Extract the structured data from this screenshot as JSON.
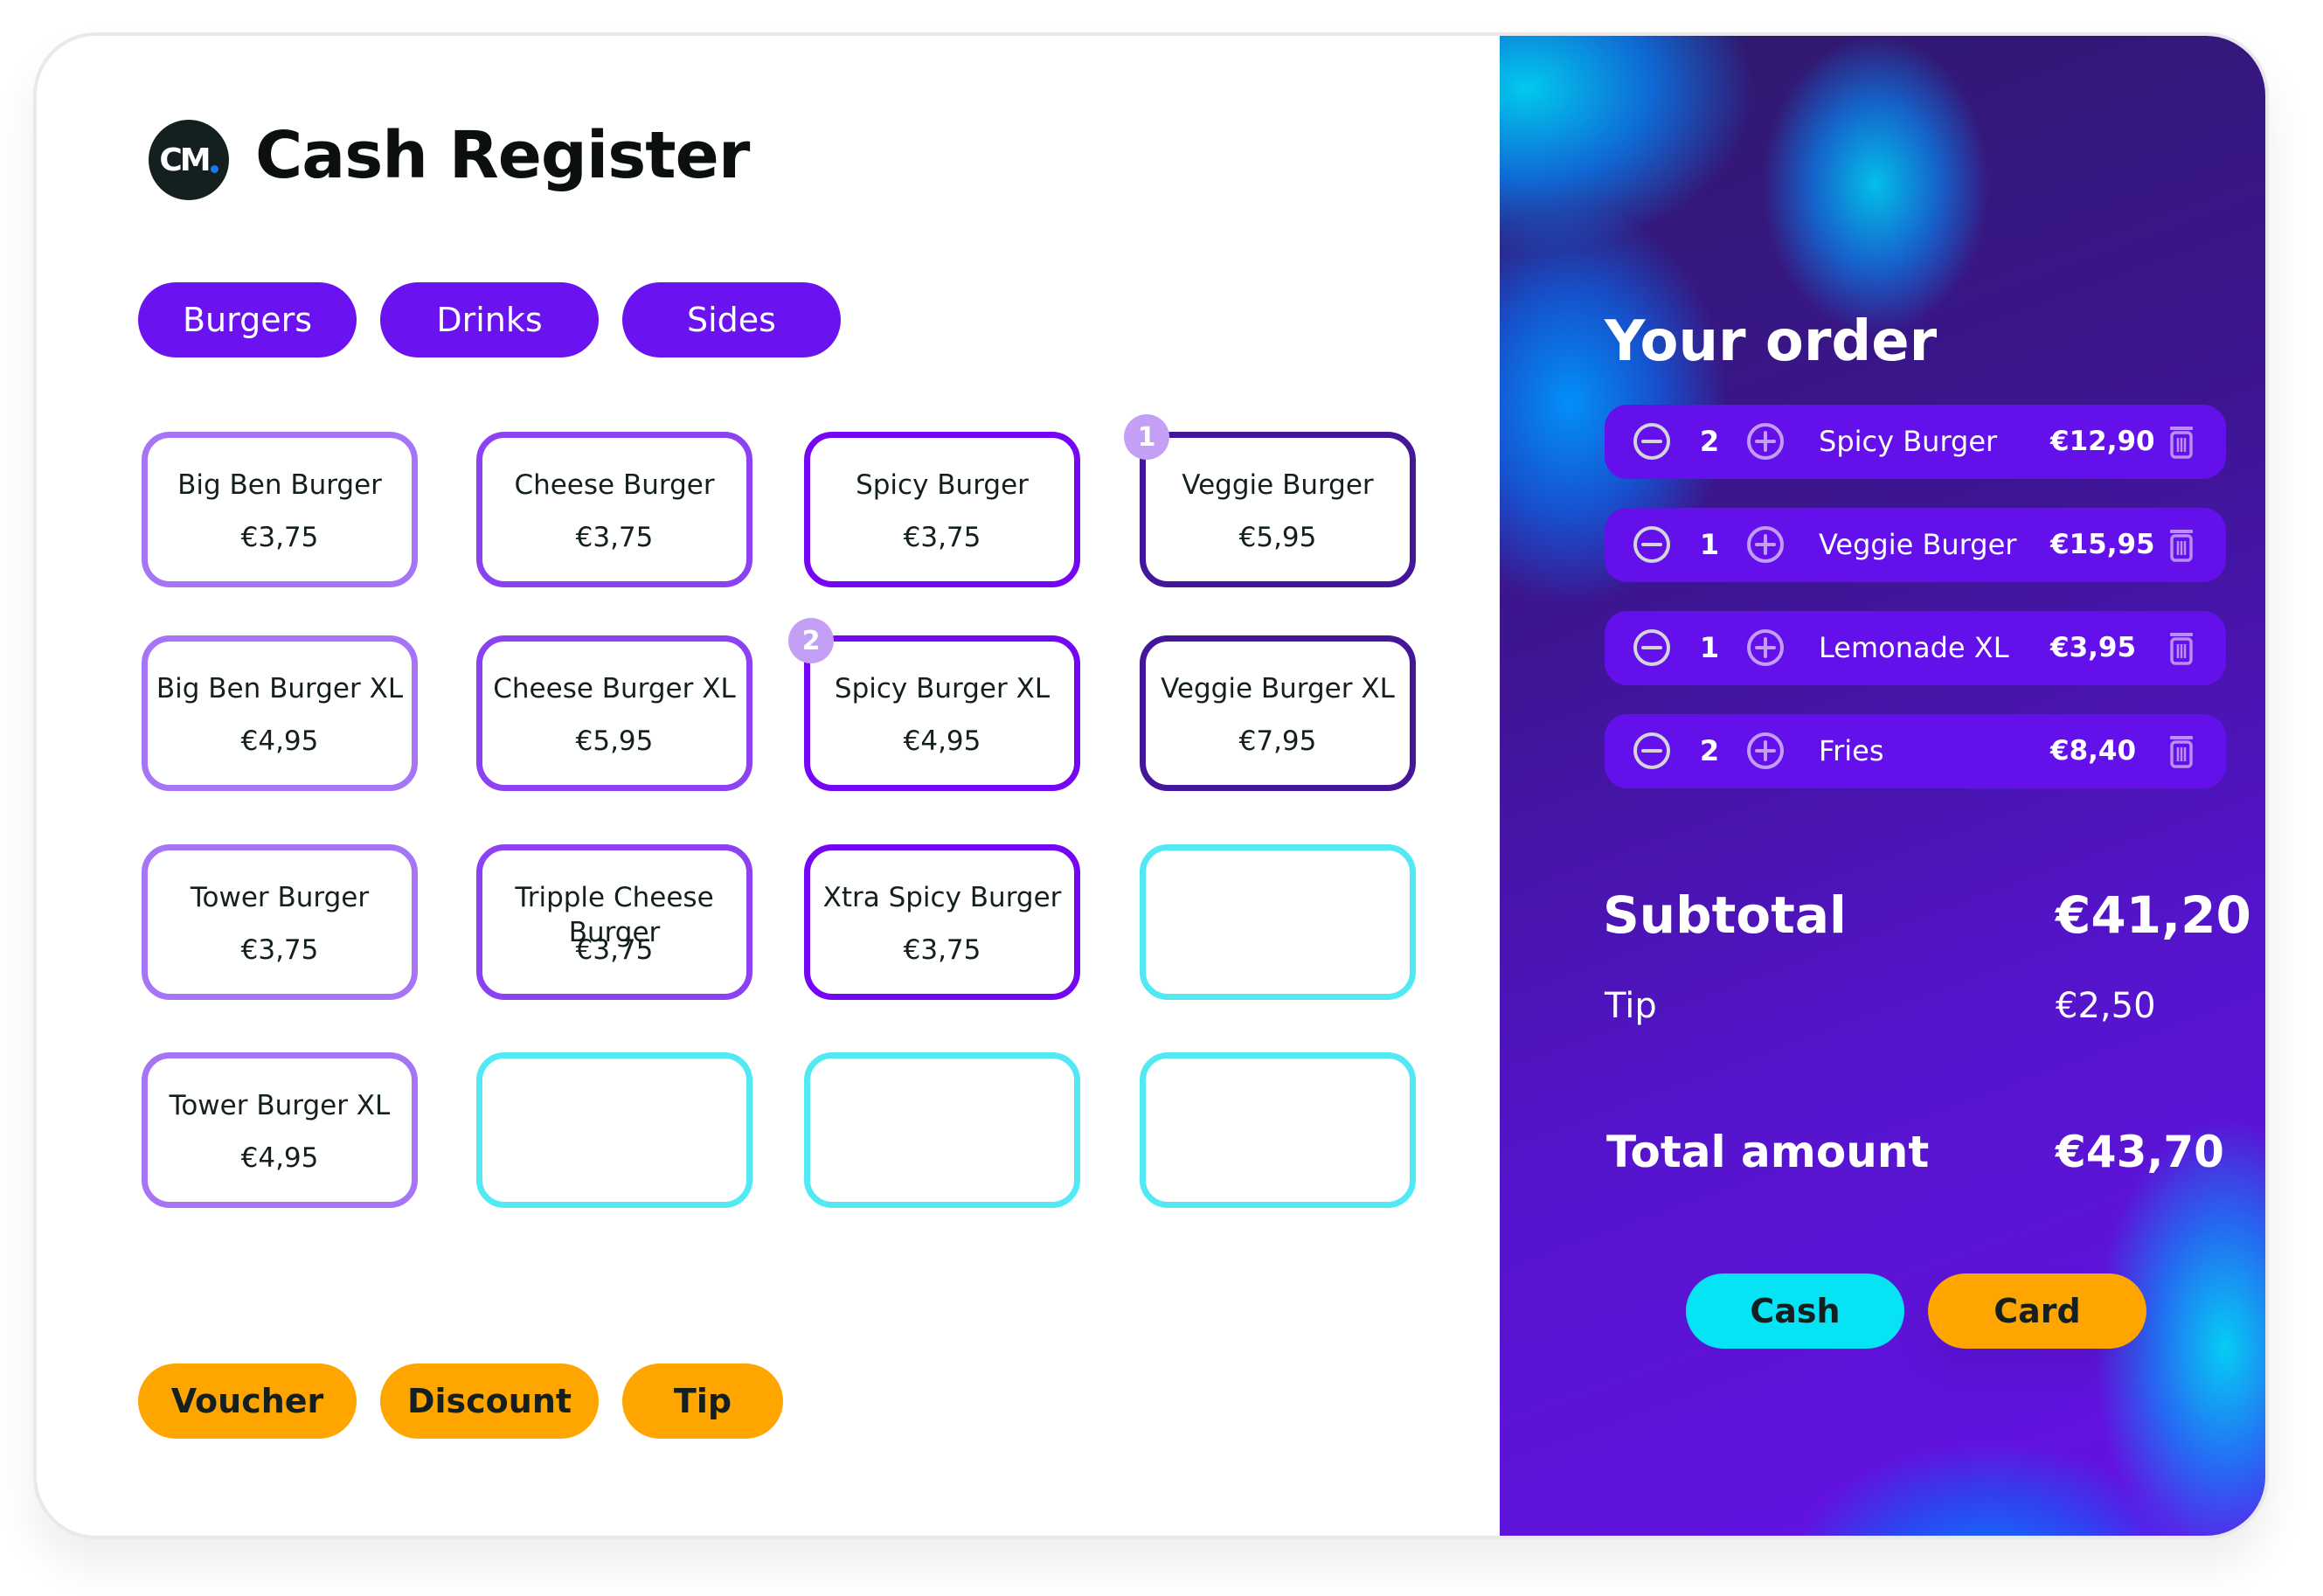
{
  "app": {
    "title": "Cash Register",
    "logo_text": "CM"
  },
  "categories": [
    {
      "label": "Burgers"
    },
    {
      "label": "Drinks"
    },
    {
      "label": "Sides"
    }
  ],
  "products": [
    {
      "name": "Big Ben Burger",
      "price": "€3,75",
      "badge": null
    },
    {
      "name": "Cheese Burger",
      "price": "€3,75",
      "badge": null
    },
    {
      "name": "Spicy Burger",
      "price": "€3,75",
      "badge": null
    },
    {
      "name": "Veggie Burger",
      "price": "€5,95",
      "badge": "1"
    },
    {
      "name": "Big Ben Burger XL",
      "price": "€4,95",
      "badge": null
    },
    {
      "name": "Cheese Burger XL",
      "price": "€5,95",
      "badge": null
    },
    {
      "name": "Spicy Burger XL",
      "price": "€4,95",
      "badge": "2"
    },
    {
      "name": "Veggie Burger XL",
      "price": "€7,95",
      "badge": null
    },
    {
      "name": "Tower Burger",
      "price": "€3,75",
      "badge": null
    },
    {
      "name": "Tripple Cheese Burger",
      "price": "€3,75",
      "badge": null
    },
    {
      "name": "Xtra Spicy Burger",
      "price": "€3,75",
      "badge": null
    },
    {
      "name": "",
      "price": "",
      "badge": null
    },
    {
      "name": "Tower Burger XL",
      "price": "€4,95",
      "badge": null
    },
    {
      "name": "",
      "price": "",
      "badge": null
    },
    {
      "name": "",
      "price": "",
      "badge": null
    },
    {
      "name": "",
      "price": "",
      "badge": null
    }
  ],
  "actions": [
    {
      "label": "Voucher"
    },
    {
      "label": "Discount"
    },
    {
      "label": "Tip"
    }
  ],
  "order": {
    "title": "Your order",
    "items": [
      {
        "qty": "2",
        "name": "Spicy Burger",
        "price": "€12,90"
      },
      {
        "qty": "1",
        "name": "Veggie Burger",
        "price": "€15,95"
      },
      {
        "qty": "1",
        "name": "Lemonade XL",
        "price": "€3,95"
      },
      {
        "qty": "2",
        "name": "Fries",
        "price": "€8,40"
      }
    ],
    "subtotal_label": "Subtotal",
    "subtotal_value": "€41,20",
    "tip_label": "Tip",
    "tip_value": "€2,50",
    "total_label": "Total amount",
    "total_value": "€43,70",
    "pay_cash_label": "Cash",
    "pay_card_label": "Card"
  },
  "colors": {
    "category_button": "#6b12f0",
    "action_button": "#ffa500",
    "cash_button": "#06e3f4",
    "card_button": "#ffa500",
    "empty_tile": "#52e9f4",
    "badge": "#c3a0f6"
  }
}
